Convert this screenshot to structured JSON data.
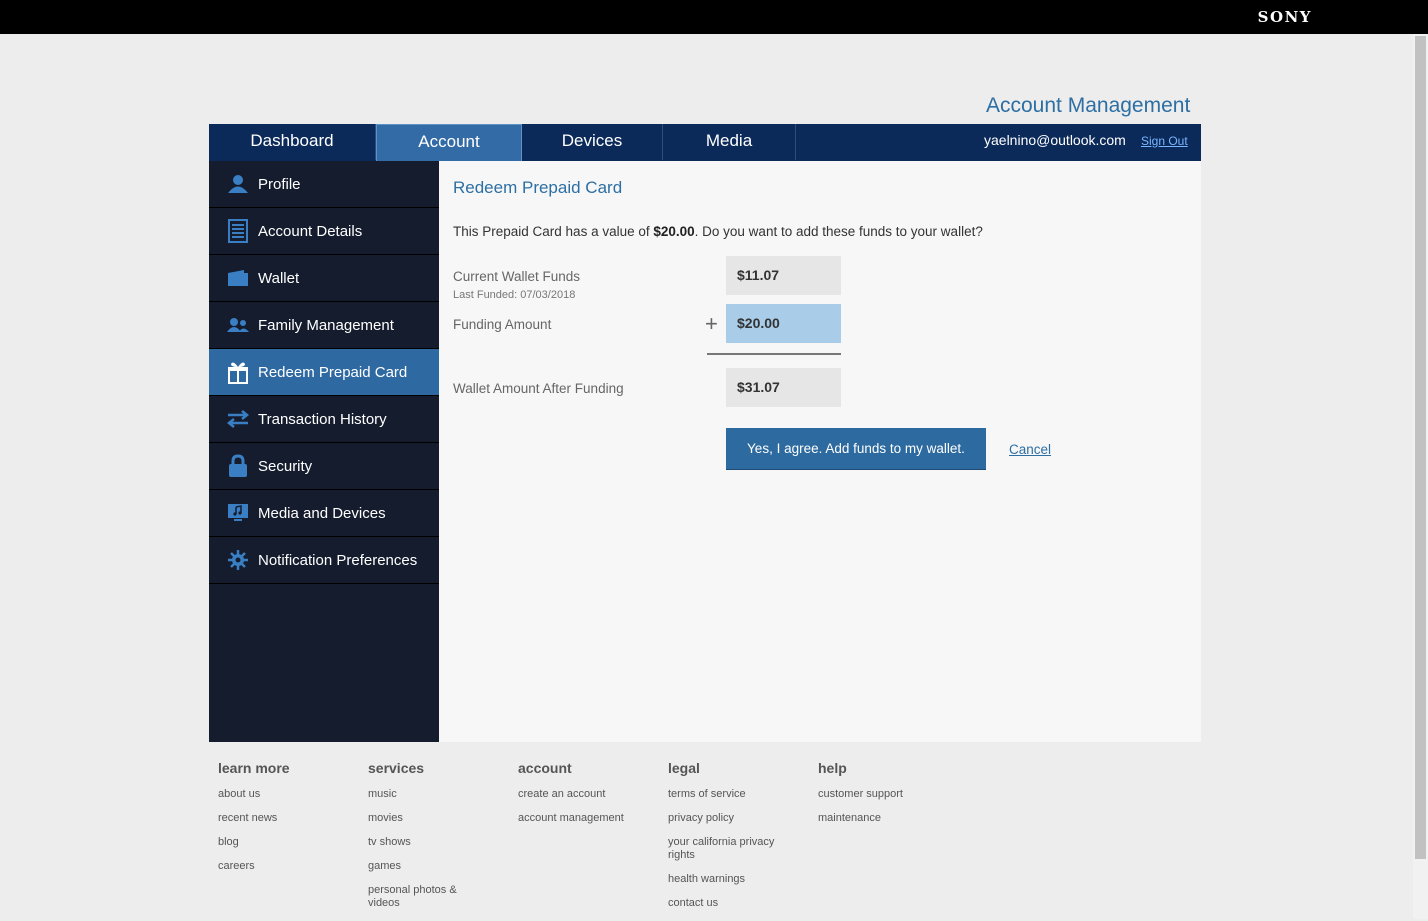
{
  "brand": "SONY",
  "page_title": "Account Management",
  "nav": {
    "tabs": [
      {
        "label": "Dashboard"
      },
      {
        "label": "Account"
      },
      {
        "label": "Devices"
      },
      {
        "label": "Media"
      }
    ],
    "active_tab": "Account",
    "user_email": "yaelnino@outlook.com",
    "sign_out": "Sign Out"
  },
  "sidebar": {
    "items": [
      {
        "label": "Profile",
        "icon": "profile-icon"
      },
      {
        "label": "Account Details",
        "icon": "account-details-icon"
      },
      {
        "label": "Wallet",
        "icon": "wallet-icon"
      },
      {
        "label": "Family Management",
        "icon": "family-icon"
      },
      {
        "label": "Redeem Prepaid Card",
        "icon": "gift-icon"
      },
      {
        "label": "Transaction History",
        "icon": "transfer-arrows-icon"
      },
      {
        "label": "Security",
        "icon": "lock-icon"
      },
      {
        "label": "Media and Devices",
        "icon": "media-devices-icon"
      },
      {
        "label": "Notification Preferences",
        "icon": "gear-icon"
      }
    ],
    "active_item": "Redeem Prepaid Card"
  },
  "redeem": {
    "title": "Redeem Prepaid Card",
    "prompt_before": "This Prepaid Card has a value of ",
    "prompt_value": "$20.00",
    "prompt_after": ". Do you want to add these funds to your wallet?",
    "current_label": "Current Wallet Funds",
    "last_funded": "Last Funded: 07/03/2018",
    "current_amount": "$11.07",
    "funding_label": "Funding Amount",
    "funding_amount": "$20.00",
    "plus": "+",
    "after_label": "Wallet Amount After Funding",
    "after_amount": "$31.07",
    "agree_button": "Yes, I agree. Add funds to my wallet.",
    "cancel": "Cancel"
  },
  "footer": {
    "columns": [
      {
        "heading": "learn more",
        "links": [
          "about us",
          "recent news",
          "blog",
          "careers"
        ]
      },
      {
        "heading": "services",
        "links": [
          "music",
          "movies",
          "tv shows",
          "games",
          "personal photos & videos"
        ]
      },
      {
        "heading": "account",
        "links": [
          "create an account",
          "account management"
        ]
      },
      {
        "heading": "legal",
        "links": [
          "terms of service",
          "privacy policy",
          "your california privacy rights",
          "health warnings",
          "contact us"
        ]
      },
      {
        "heading": "help",
        "links": [
          "customer support",
          "maintenance"
        ]
      }
    ]
  },
  "colors": {
    "nav_bg": "#0b2a5a",
    "active_tab": "#336ba6",
    "sidebar_bg": "#141c2e",
    "sidebar_active": "#2e69a2",
    "accent": "#2d6fa3",
    "funding_highlight": "#a9cce8"
  }
}
